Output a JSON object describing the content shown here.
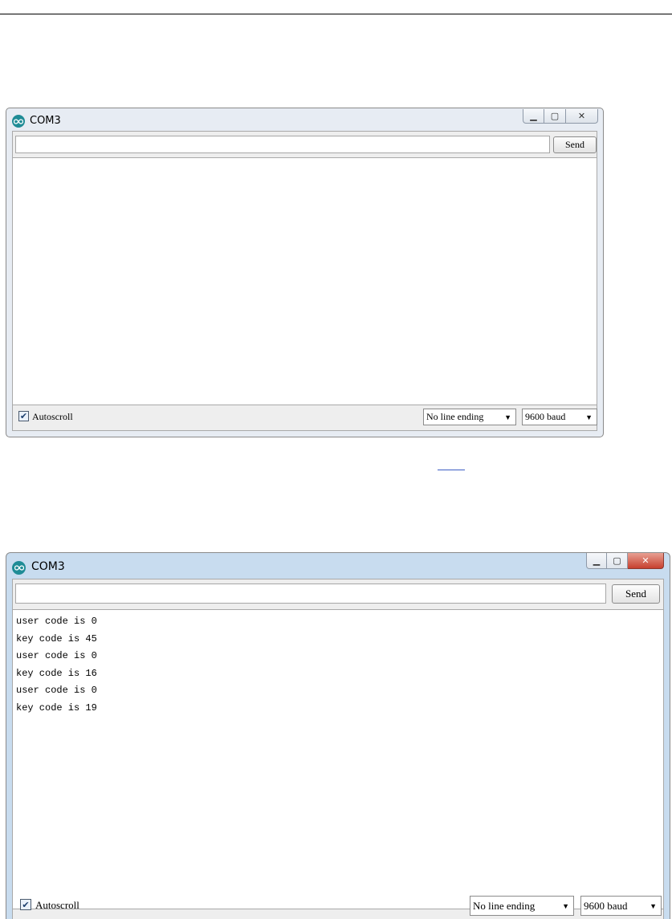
{
  "windows": [
    {
      "title": "COM3",
      "send_input_value": "",
      "send_label": "Send",
      "output_lines": [],
      "autoscroll_label": "Autoscroll",
      "autoscroll_checked": true,
      "line_ending": "No line ending",
      "baud": "9600 baud"
    },
    {
      "title": "COM3",
      "send_input_value": "",
      "send_label": "Send",
      "output_lines": [
        "user code is 0",
        "key code is 45",
        "user code is 0",
        "key code is 16",
        "user code is 0",
        "key code is 19"
      ],
      "autoscroll_label": "Autoscroll",
      "autoscroll_checked": true,
      "line_ending": "No line ending",
      "baud": "9600 baud"
    }
  ],
  "icons": {
    "app": "arduino-infinity-icon",
    "minimize": "minimize-icon",
    "maximize": "maximize-icon",
    "close": "close-icon",
    "checkbox": "checkmark-icon",
    "dropdown": "dropdown-arrow-icon"
  },
  "colors": {
    "arduino_teal": "#1f8c96",
    "close_red": "#c7402f",
    "frame_blue": "#c8dcef"
  }
}
